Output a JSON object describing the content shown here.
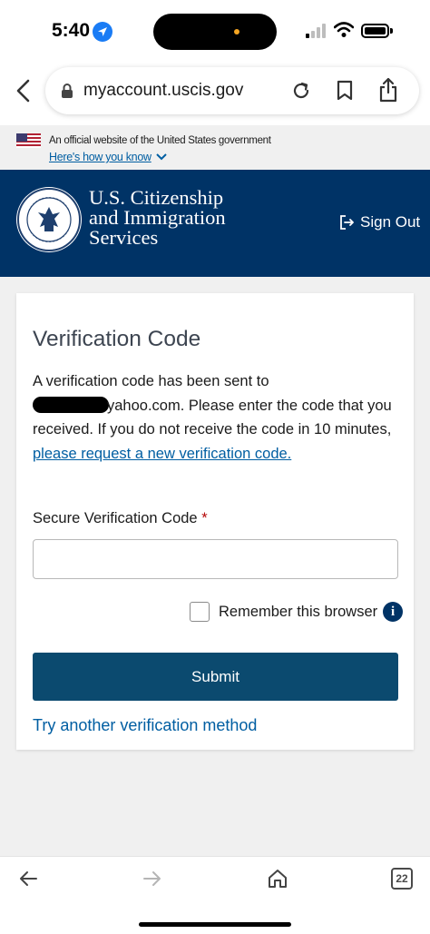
{
  "status": {
    "time": "5:40"
  },
  "browser": {
    "url": "myaccount.uscis.gov",
    "tab_count": "22"
  },
  "gov_banner": {
    "official_text": "An official website of the United States government",
    "how_link": "Here's how you know"
  },
  "agency": {
    "name_line1": "U.S. Citizenship",
    "name_line2": "and Immigration",
    "name_line3": "Services",
    "signout_label": "Sign Out"
  },
  "card": {
    "title": "Verification Code",
    "body_prefix": "A verification code has been sent to",
    "email_suffix": "yahoo.com. Please enter the code that you received. If you do not receive the code in 10 minutes,",
    "request_link": "please request a new verification code.",
    "field_label": "Secure Verification Code",
    "required_mark": "*",
    "input_value": "",
    "remember_label": "Remember this browser",
    "remember_checked": false,
    "submit_label": "Submit",
    "alt_method_link": "Try another verification method"
  },
  "colors": {
    "header_bg": "#003366",
    "submit_bg": "#0b4a6f",
    "link": "#005ea2",
    "required": "#b50909"
  }
}
